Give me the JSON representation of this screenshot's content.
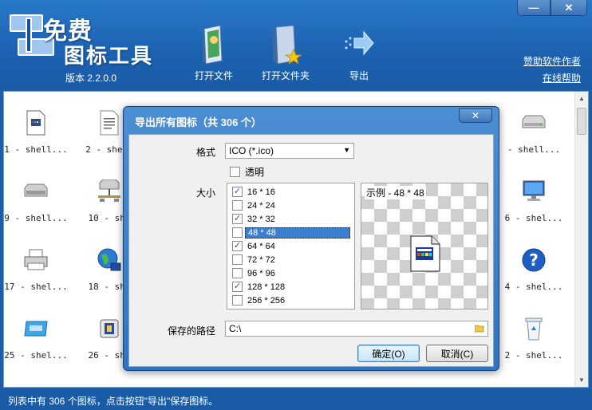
{
  "header": {
    "app_name_line1": "免费",
    "app_name_line2": "图标工具",
    "version": "版本 2.2.0.0",
    "tools": [
      {
        "label": "打开文件",
        "icon": "open-file-icon"
      },
      {
        "label": "打开文件夹",
        "icon": "open-folder-icon"
      },
      {
        "label": "导出",
        "icon": "export-arrow-icon"
      }
    ],
    "links": {
      "sponsor": "赞助软件作者",
      "help": "在线帮助"
    },
    "window_controls": {
      "minimize": "—",
      "close": "✕"
    }
  },
  "icons": [
    {
      "caption": "1 - shell...",
      "icon": "document-icon"
    },
    {
      "caption": "2 - shell",
      "icon": "text-document-icon"
    },
    {
      "caption": "- shell...",
      "icon": "drive-icon"
    },
    {
      "caption": "9 - shell...",
      "icon": "removable-drive-icon"
    },
    {
      "caption": "10 - she",
      "icon": "network-drive-icon"
    },
    {
      "caption": "6 - shel...",
      "icon": "monitor-icon"
    },
    {
      "caption": "17 - shel...",
      "icon": "printer-icon"
    },
    {
      "caption": "18 - she",
      "icon": "globe-network-icon"
    },
    {
      "caption": "4 - shel...",
      "icon": "help-icon"
    },
    {
      "caption": "25 - shel...",
      "icon": "card-icon"
    },
    {
      "caption": "26 - she",
      "icon": "media-icon"
    },
    {
      "caption": "2 - shel...",
      "icon": "recycle-bin-icon"
    }
  ],
  "status": "列表中有 306 个图标，点击按钮\"导出\"保存图标。",
  "dialog": {
    "title": "导出所有图标（共 306 个）",
    "close": "✕",
    "format_label": "格式",
    "format_value": "ICO (*.ico)",
    "transparent_label": "透明",
    "size_label": "大小",
    "sizes": [
      {
        "label": "16 * 16",
        "checked": true
      },
      {
        "label": "24 * 24",
        "checked": false
      },
      {
        "label": "32 * 32",
        "checked": true
      },
      {
        "label": "48 * 48",
        "checked": false
      },
      {
        "label": "64 * 64",
        "checked": true
      },
      {
        "label": "72 * 72",
        "checked": false
      },
      {
        "label": "96 * 96",
        "checked": false
      },
      {
        "label": "128 * 128",
        "checked": true
      },
      {
        "label": "256 * 256",
        "checked": false
      }
    ],
    "selected_size": "48 * 48",
    "preview_label": "示例 - 48 * 48",
    "path_label": "保存的路径",
    "path_value": "C:\\",
    "ok_label": "确定(O)",
    "cancel_label": "取消(C)"
  }
}
